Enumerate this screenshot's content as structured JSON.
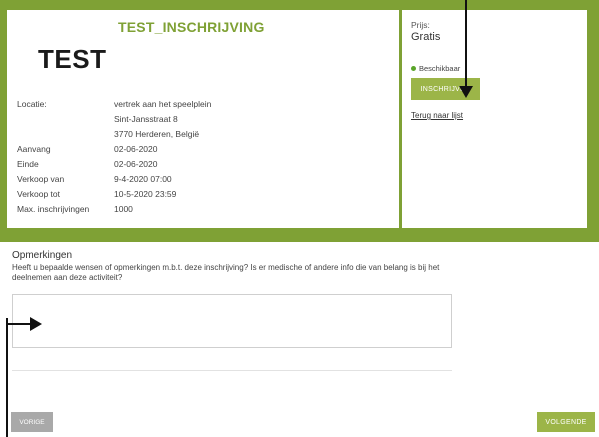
{
  "event": {
    "title": "TEST_INSCHRIJVING",
    "logo_text": "TEST",
    "details": [
      {
        "label": "Locatie:",
        "value": "vertrek aan het speelplein"
      },
      {
        "label": "",
        "value": "Sint-Jansstraat 8"
      },
      {
        "label": "",
        "value": "3770 Herderen, België"
      },
      {
        "label": "Aanvang",
        "value": "02-06-2020"
      },
      {
        "label": "Einde",
        "value": "02-06-2020"
      },
      {
        "label": "Verkoop van",
        "value": "9-4-2020 07:00"
      },
      {
        "label": "Verkoop tot",
        "value": "10-5-2020 23:59"
      },
      {
        "label": "Max. inschrijvingen",
        "value": "1000"
      }
    ]
  },
  "sidebar": {
    "price_label": "Prijs:",
    "price_value": "Gratis",
    "availability": "Beschikbaar",
    "availability_color": "#5aa52a",
    "register_button": "INSCHRIJVEN",
    "back_link": "Terug naar lijst"
  },
  "remarks": {
    "title": "Opmerkingen",
    "description": "Heeft u bepaalde wensen of opmerkingen m.b.t. deze inschrijving? Is er medische of andere info die van belang is bij het deelnemen aan deze activiteit?",
    "value": ""
  },
  "navigation": {
    "prev_button": "VORIGE",
    "next_button": "VOLGENDE"
  },
  "colors": {
    "accent_green": "#7fa135",
    "button_green": "#9cb548",
    "button_grey": "#a9a9a9"
  }
}
